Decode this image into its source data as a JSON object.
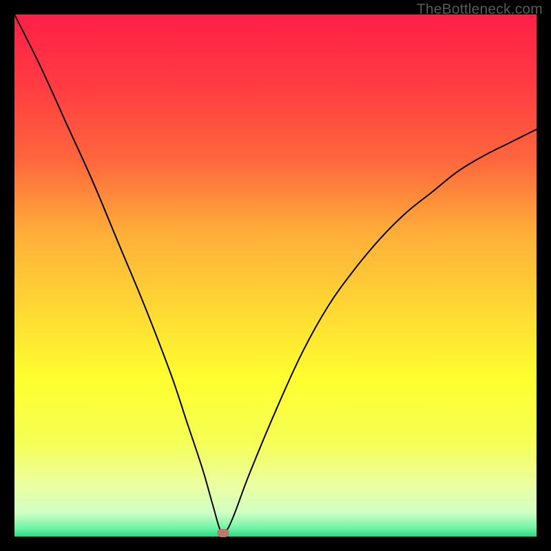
{
  "watermark": "TheBottleneck.com",
  "chart_data": {
    "type": "line",
    "title": "",
    "xlabel": "",
    "ylabel": "",
    "xlim": [
      0,
      100
    ],
    "ylim": [
      0,
      100
    ],
    "series": [
      {
        "name": "bottleneck-curve",
        "x": [
          0,
          5,
          10,
          15,
          20,
          25,
          30,
          33,
          36,
          38,
          39.5,
          40.5,
          42,
          45,
          50,
          55,
          60,
          65,
          70,
          75,
          80,
          85,
          90,
          95,
          100
        ],
        "values": [
          100,
          90,
          79,
          68,
          56,
          44,
          31,
          22,
          13,
          6,
          1,
          1,
          4,
          12,
          24,
          35,
          44,
          51,
          57,
          62,
          66,
          70,
          73,
          75.5,
          78
        ]
      }
    ],
    "marker": {
      "x": 40,
      "y": 0.6,
      "color": "#bf7868"
    },
    "background_gradient": {
      "stops": [
        {
          "pos": 0.0,
          "color": "#ff1f48"
        },
        {
          "pos": 0.14,
          "color": "#ff3d42"
        },
        {
          "pos": 0.28,
          "color": "#fe673d"
        },
        {
          "pos": 0.42,
          "color": "#feaf39"
        },
        {
          "pos": 0.56,
          "color": "#fed734"
        },
        {
          "pos": 0.7,
          "color": "#feff2f"
        },
        {
          "pos": 0.82,
          "color": "#f5ff56"
        },
        {
          "pos": 0.9,
          "color": "#ecffa0"
        },
        {
          "pos": 0.955,
          "color": "#d0ffc5"
        },
        {
          "pos": 0.985,
          "color": "#6bf3a4"
        },
        {
          "pos": 1.0,
          "color": "#27d885"
        }
      ]
    },
    "curve_style": {
      "stroke": "#000000",
      "stroke_width": 2
    }
  }
}
